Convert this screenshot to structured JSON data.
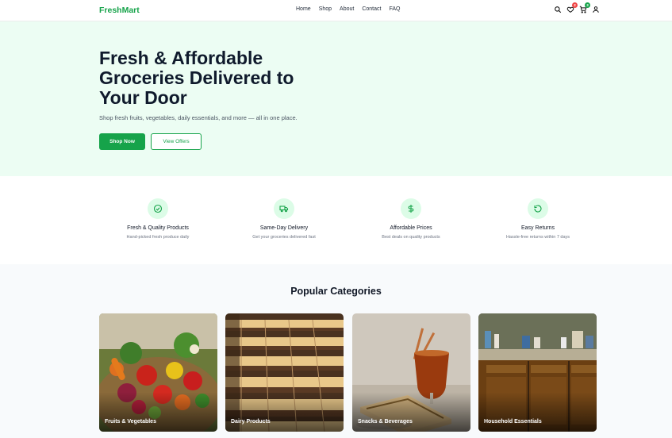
{
  "brand": {
    "logo": "FreshMart",
    "color": "#16a34a"
  },
  "nav": {
    "items": [
      "Home",
      "Shop",
      "About",
      "Contact",
      "FAQ"
    ]
  },
  "header_icons": {
    "search": "search-icon",
    "wishlist": {
      "icon": "heart-icon",
      "count": "2"
    },
    "cart": {
      "icon": "cart-icon",
      "count": "3"
    },
    "account": "user-icon"
  },
  "hero": {
    "title": "Fresh & Affordable Groceries Delivered to Your Door",
    "subtitle": "Shop fresh fruits, vegetables, daily essentials, and more — all in one place.",
    "primary_cta": "Shop Now",
    "secondary_cta": "View Offers"
  },
  "features": [
    {
      "icon": "check-circle-icon",
      "title": "Fresh & Quality Products",
      "desc": "Hand-picked fresh produce daily"
    },
    {
      "icon": "truck-icon",
      "title": "Same-Day Delivery",
      "desc": "Get your groceries delivered fast"
    },
    {
      "icon": "dollar-icon",
      "title": "Affordable Prices",
      "desc": "Best deals on quality products"
    },
    {
      "icon": "refresh-icon",
      "title": "Easy Returns",
      "desc": "Hassle-free returns within 7 days"
    }
  ],
  "categories": {
    "title": "Popular Categories",
    "items": [
      {
        "label": "Fruits & Vegetables"
      },
      {
        "label": "Dairy Products"
      },
      {
        "label": "Snacks & Beverages"
      },
      {
        "label": "Household Essentials"
      }
    ]
  }
}
